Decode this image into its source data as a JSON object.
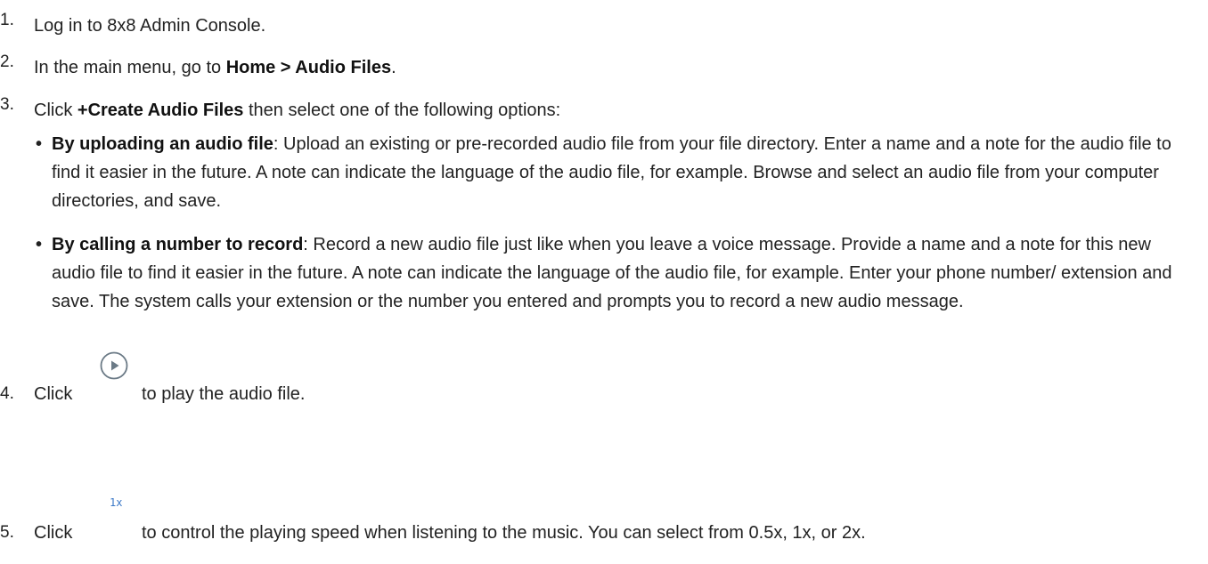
{
  "steps": [
    {
      "num": "1.",
      "text": "Log in to 8x8 Admin Console."
    },
    {
      "num": "2.",
      "pre": "In the main menu, go to ",
      "bold": "Home > Audio Files",
      "post": "."
    },
    {
      "num": "3.",
      "pre": "Click ",
      "bold": "+Create Audio Files",
      "post": " then select one of the following options:"
    },
    {
      "num": "4.",
      "pre": "Click ",
      "post": "to play the audio file."
    },
    {
      "num": "5.",
      "pre": "Click ",
      "post": "to control the playing speed when listening to the music. You can select from 0.5x, 1x, or 2x."
    }
  ],
  "options": [
    {
      "bold": "By uploading an audio file",
      "text": ": Upload an existing or pre-recorded audio file from your file directory. Enter a name and a note for the audio file to find it easier in the future. A note can indicate the language of the audio file, for example. Browse and select an audio file from your computer directories, and save."
    },
    {
      "bold": "By calling a number to record",
      "text": ": Record a new audio file just like when you leave a voice message. Provide a name and a note for this new audio file to find it easier in the future. A note can indicate the language of the audio file, for example. Enter your phone number/ extension and save. The system calls your extension or the number you entered and prompts you to record a new audio message."
    }
  ],
  "icons": {
    "play": "play-circle-icon",
    "speed": "speed-1x-icon",
    "speed_label": "1x",
    "accent": "#3a78c7"
  }
}
